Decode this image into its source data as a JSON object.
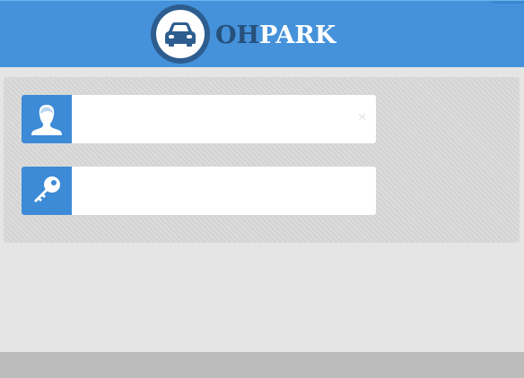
{
  "header": {
    "logo": {
      "icon": "car-icon",
      "text_part1": "OH",
      "text_part2": "PARK"
    }
  },
  "login_form": {
    "username": {
      "icon": "user-icon",
      "value": "",
      "placeholder": "",
      "clear_glyph": "✕"
    },
    "password": {
      "icon": "key-icon",
      "value": "",
      "placeholder": ""
    }
  },
  "colors": {
    "header_bg": "#4592db",
    "icon_bg": "#3d8ad6",
    "logo_dark": "#264f7a",
    "page_bg": "#e5e5e5",
    "footer_bg": "#bcbcbc"
  }
}
